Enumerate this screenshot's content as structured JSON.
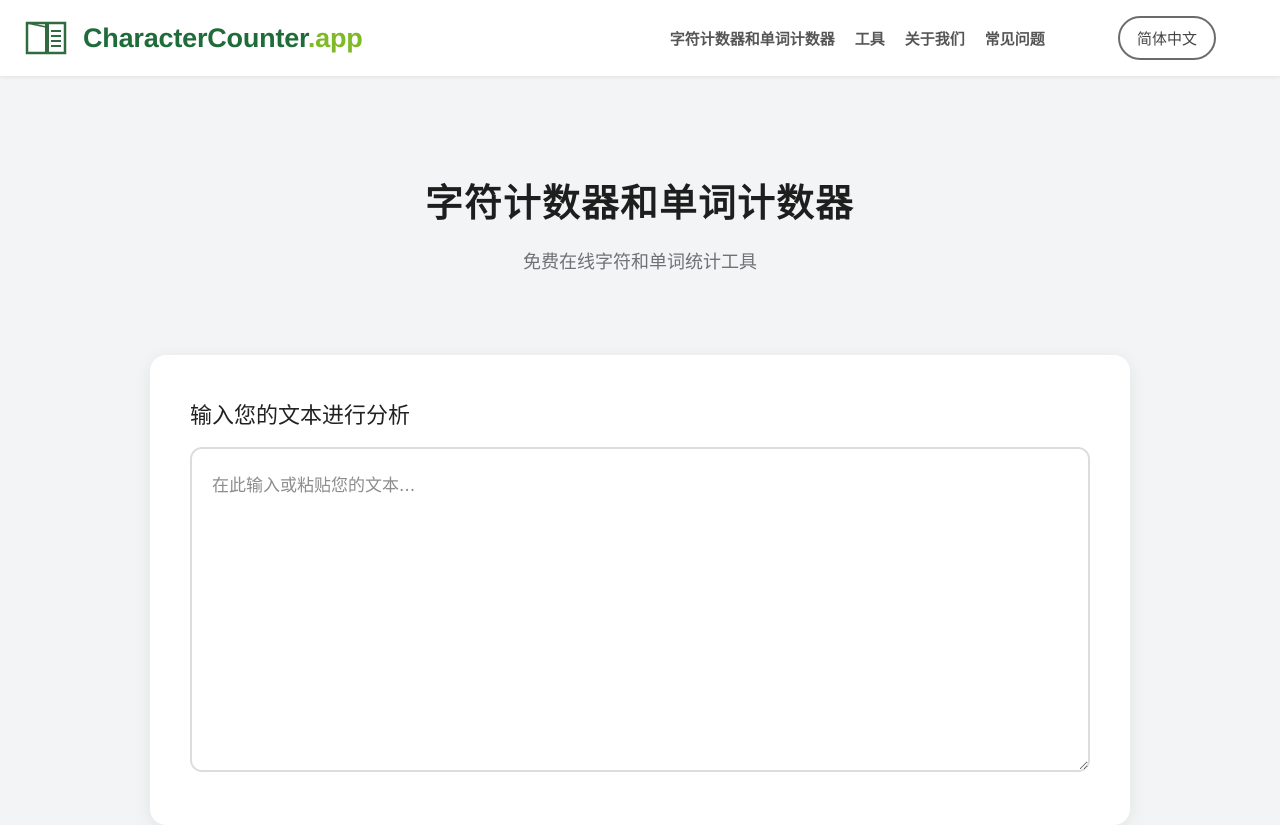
{
  "header": {
    "brand": {
      "name_main": "CharacterCounter",
      "name_suffix": ".app",
      "icon": "open-book-icon",
      "brand_color": "#1f6b3a",
      "accent_color": "#7fb927"
    },
    "nav": [
      {
        "label": "字符计数器和单词计数器"
      },
      {
        "label": "工具"
      },
      {
        "label": "关于我们"
      },
      {
        "label": "常见问题"
      }
    ],
    "language_button": "简体中文"
  },
  "hero": {
    "title": "字符计数器和单词计数器",
    "subtitle": "免费在线字符和单词统计工具"
  },
  "editor": {
    "label": "输入您的文本进行分析",
    "placeholder": "在此输入或粘贴您的文本...",
    "value": ""
  }
}
